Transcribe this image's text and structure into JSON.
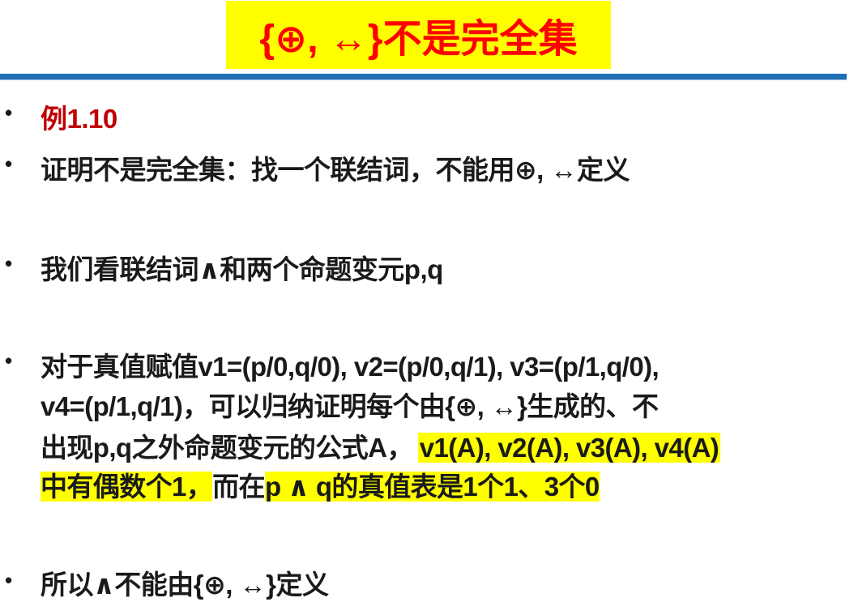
{
  "title": "{⊕, ↔}不是完全集",
  "colors": {
    "title_text": "#ff0000",
    "title_bg": "#ffff00",
    "rule": "#1f6fb6",
    "example_label": "#c00000",
    "highlight": "#ffff00"
  },
  "bullets": {
    "b1": "例1.10",
    "b2": "证明不是完全集：找一个联结词，不能用⊕, ↔定义",
    "b3": "我们看联结词∧和两个命题变元p,q",
    "b4": {
      "line1": "对于真值赋值v1=(p/0,q/0), v2=(p/0,q/1), v3=(p/1,q/0),",
      "line2": "v4=(p/1,q/1)，可以归纳证明每个由{⊕, ↔}生成的、不",
      "line3_plain": "出现p,q之外命题变元的公式A，",
      "line3_hl": "v1(A), v2(A), v3(A), v4(A)",
      "line4_hl1": "中有偶数个1，",
      "line4_plain": "而在",
      "line4_hl2": "p ∧ q的真值表是1个1、3个0"
    },
    "b5": "所以∧不能由{⊕, ↔}定义"
  },
  "bullet_char": "•"
}
